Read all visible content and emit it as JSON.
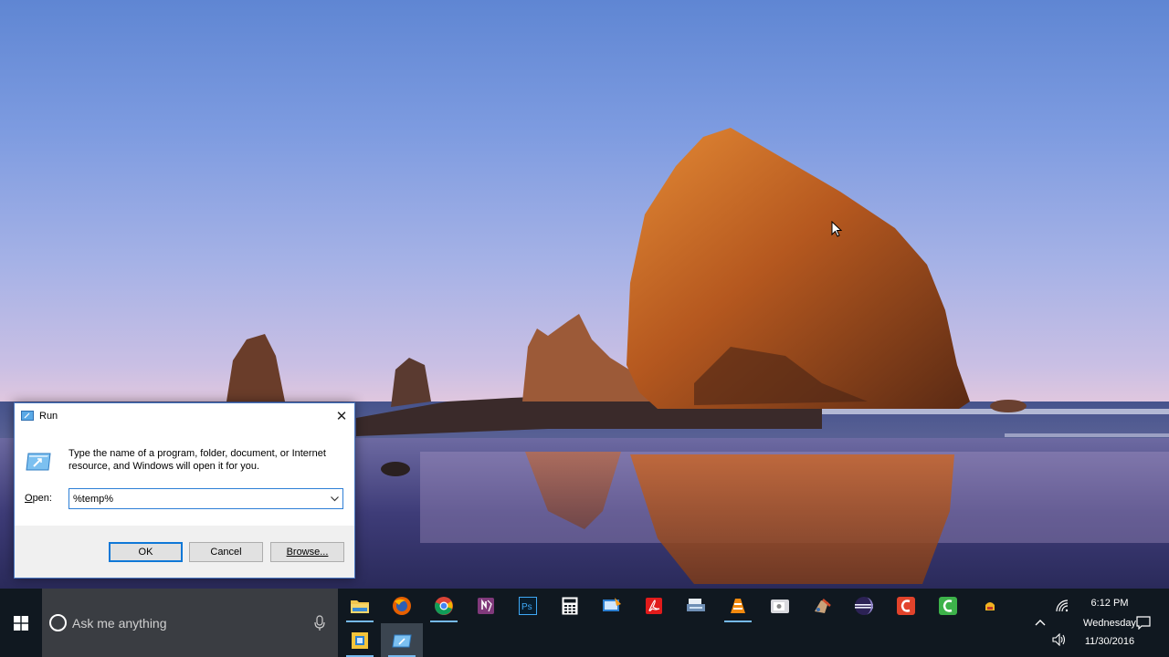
{
  "desktop": {
    "wallpaper": "Sea stack rock at sunset with reflection on wet sand beach"
  },
  "run_dialog": {
    "title": "Run",
    "close_icon": "close-icon",
    "description": "Type the name of a program, folder, document, or Internet resource, and Windows will open it for you.",
    "open_label": "Open:",
    "open_value": "%temp%",
    "buttons": {
      "ok": "OK",
      "cancel": "Cancel",
      "browse": "Browse..."
    }
  },
  "taskbar": {
    "search_placeholder": "Ask me anything",
    "pinned_apps": [
      {
        "name": "file-explorer",
        "running": true
      },
      {
        "name": "firefox",
        "running": false
      },
      {
        "name": "chrome",
        "running": true
      },
      {
        "name": "onenote",
        "running": false
      },
      {
        "name": "photoshop",
        "running": false
      },
      {
        "name": "calculator",
        "running": false
      },
      {
        "name": "screen-capture",
        "running": false
      },
      {
        "name": "acrobat-reader",
        "running": false
      },
      {
        "name": "scanner",
        "running": false
      },
      {
        "name": "vlc",
        "running": true
      },
      {
        "name": "camera-app",
        "running": false
      },
      {
        "name": "paint-tool",
        "running": false
      },
      {
        "name": "eclipse",
        "running": false
      },
      {
        "name": "camtasia-recorder",
        "running": false
      },
      {
        "name": "camtasia-studio",
        "running": false
      },
      {
        "name": "misc-app",
        "running": false
      }
    ],
    "clock": {
      "time": "6:12 PM",
      "day": "Wednesday",
      "date": "11/30/2016"
    }
  },
  "colors": {
    "taskbar_bg": "#101820",
    "search_bg": "#3a3d42",
    "accent": "#0f78d7",
    "running_indicator": "#76b9ed"
  }
}
